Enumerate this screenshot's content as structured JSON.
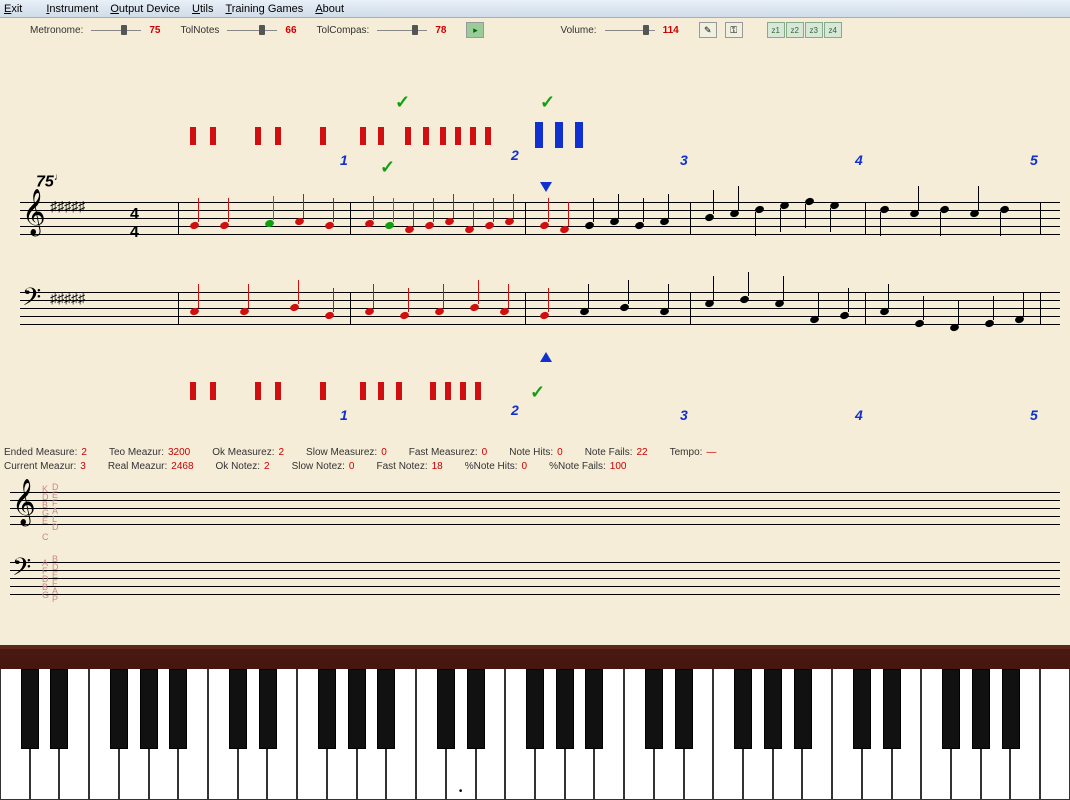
{
  "menu": {
    "items": [
      "Exit",
      "Instrument",
      "Output Device",
      "Utils",
      "Training Games",
      "About"
    ]
  },
  "toolbar": {
    "metronome_label": "Metronome:",
    "metronome_val": "75",
    "tolnotes_label": "TolNotes",
    "tolnotes_val": "66",
    "tolcompas_label": "TolCompas:",
    "tolcompas_val": "78",
    "volume_label": "Volume:",
    "volume_val": "114",
    "zoom": [
      "z1",
      "z2",
      "z3",
      "z4"
    ]
  },
  "score": {
    "tempo": "75",
    "measure_nums_top": [
      "1",
      "2",
      "3",
      "4",
      "5"
    ],
    "measure_nums_bottom": [
      "1",
      "2",
      "3",
      "4",
      "5"
    ]
  },
  "stats": {
    "row1": [
      {
        "l": "Ended Measure:",
        "v": "2"
      },
      {
        "l": "Teo Meazur:",
        "v": "3200"
      },
      {
        "l": "Ok Measurez:",
        "v": "2"
      },
      {
        "l": "Slow Measurez:",
        "v": "0"
      },
      {
        "l": "Fast Measurez:",
        "v": "0"
      },
      {
        "l": "Note Hits:",
        "v": "0"
      },
      {
        "l": "Note Fails:",
        "v": "22"
      },
      {
        "l": "Tempo:",
        "v": "—"
      }
    ],
    "row2": [
      {
        "l": "Current Meazur:",
        "v": "3"
      },
      {
        "l": "Real Meazur:",
        "v": "2468"
      },
      {
        "l": "Ok Notez:",
        "v": "2"
      },
      {
        "l": "Slow Notez:",
        "v": "0"
      },
      {
        "l": "Fast Notez:",
        "v": "18"
      },
      {
        "l": "%Note Hits:",
        "v": "0"
      },
      {
        "l": "%Note Fails:",
        "v": "100"
      }
    ]
  },
  "note_letters_treble": [
    "K",
    "D",
    "B",
    "G",
    "E",
    "C"
  ],
  "note_letters_treble2": [
    "D",
    "E",
    "F",
    "A",
    "L",
    "D"
  ],
  "note_letters_bass": [
    "A",
    "F",
    "D",
    "B",
    "G"
  ],
  "note_letters_bass2": [
    "B",
    "D",
    "E",
    "F",
    "A",
    "P"
  ]
}
